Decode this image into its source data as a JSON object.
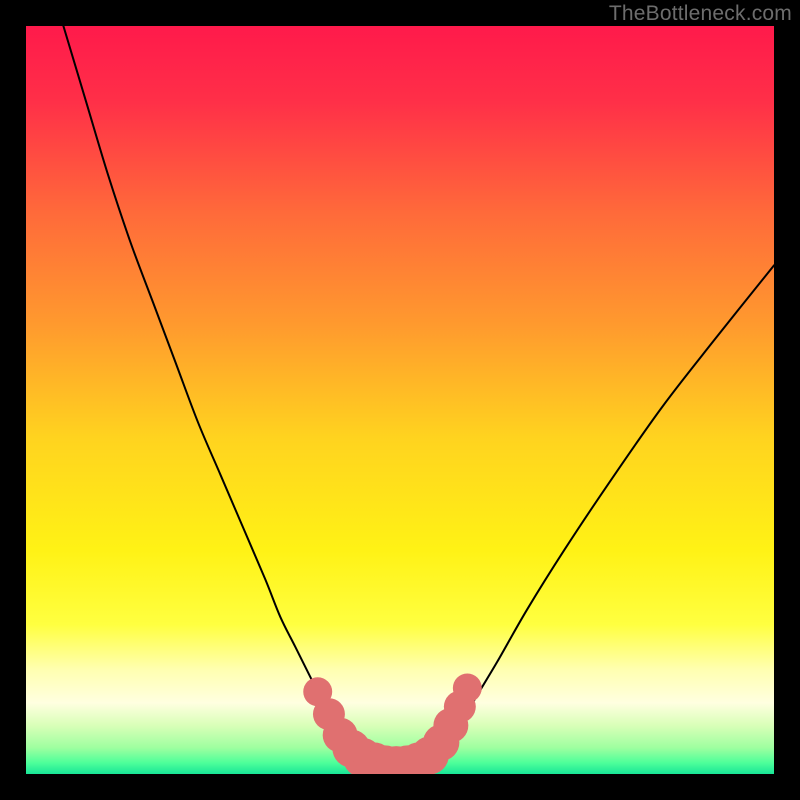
{
  "watermark": "TheBottleneck.com",
  "chart_data": {
    "type": "line",
    "title": "",
    "xlabel": "",
    "ylabel": "",
    "xlim": [
      0,
      100
    ],
    "ylim": [
      0,
      100
    ],
    "grid": false,
    "background": {
      "type": "vertical-gradient",
      "stops": [
        {
          "offset": 0.0,
          "color": "#ff1a4b"
        },
        {
          "offset": 0.1,
          "color": "#ff2f48"
        },
        {
          "offset": 0.25,
          "color": "#ff6a3a"
        },
        {
          "offset": 0.4,
          "color": "#ff9a2e"
        },
        {
          "offset": 0.55,
          "color": "#ffd31f"
        },
        {
          "offset": 0.7,
          "color": "#fff215"
        },
        {
          "offset": 0.8,
          "color": "#ffff40"
        },
        {
          "offset": 0.86,
          "color": "#ffffb0"
        },
        {
          "offset": 0.905,
          "color": "#ffffe0"
        },
        {
          "offset": 0.935,
          "color": "#d9ffb8"
        },
        {
          "offset": 0.965,
          "color": "#9effa0"
        },
        {
          "offset": 0.985,
          "color": "#4eff9a"
        },
        {
          "offset": 1.0,
          "color": "#18e597"
        }
      ]
    },
    "series": [
      {
        "name": "bottleneck-curve",
        "stroke": "#000000",
        "stroke_width": 2,
        "x": [
          5,
          8,
          11,
          14,
          17,
          20,
          23,
          26,
          29,
          32,
          34,
          36,
          38,
          40,
          41.5,
          43,
          44.5,
          46,
          47.5,
          49,
          50.5,
          52,
          54,
          56,
          58,
          60,
          63,
          67,
          72,
          78,
          85,
          92,
          100
        ],
        "y": [
          100,
          90,
          80,
          71,
          63,
          55,
          47,
          40,
          33,
          26,
          21,
          17,
          13,
          9,
          6.5,
          4.5,
          3,
          2,
          1.3,
          1.0,
          1.0,
          1.3,
          2.2,
          4,
          6.5,
          10,
          15,
          22,
          30,
          39,
          49,
          58,
          68
        ]
      }
    ],
    "markers": {
      "name": "highlight-dots",
      "fill": "#e07070",
      "points": [
        {
          "x": 39.0,
          "y": 11.0,
          "r": 1.4
        },
        {
          "x": 40.5,
          "y": 8.0,
          "r": 1.6
        },
        {
          "x": 42.0,
          "y": 5.2,
          "r": 1.8
        },
        {
          "x": 43.5,
          "y": 3.4,
          "r": 2.0
        },
        {
          "x": 45.0,
          "y": 2.2,
          "r": 2.1
        },
        {
          "x": 46.5,
          "y": 1.5,
          "r": 2.2
        },
        {
          "x": 48.0,
          "y": 1.1,
          "r": 2.2
        },
        {
          "x": 49.5,
          "y": 1.0,
          "r": 2.2
        },
        {
          "x": 51.0,
          "y": 1.1,
          "r": 2.2
        },
        {
          "x": 52.5,
          "y": 1.6,
          "r": 2.1
        },
        {
          "x": 54.0,
          "y": 2.5,
          "r": 2.0
        },
        {
          "x": 55.5,
          "y": 4.2,
          "r": 1.9
        },
        {
          "x": 56.8,
          "y": 6.5,
          "r": 1.8
        },
        {
          "x": 58.0,
          "y": 9.0,
          "r": 1.6
        },
        {
          "x": 59.0,
          "y": 11.5,
          "r": 1.4
        }
      ]
    }
  }
}
